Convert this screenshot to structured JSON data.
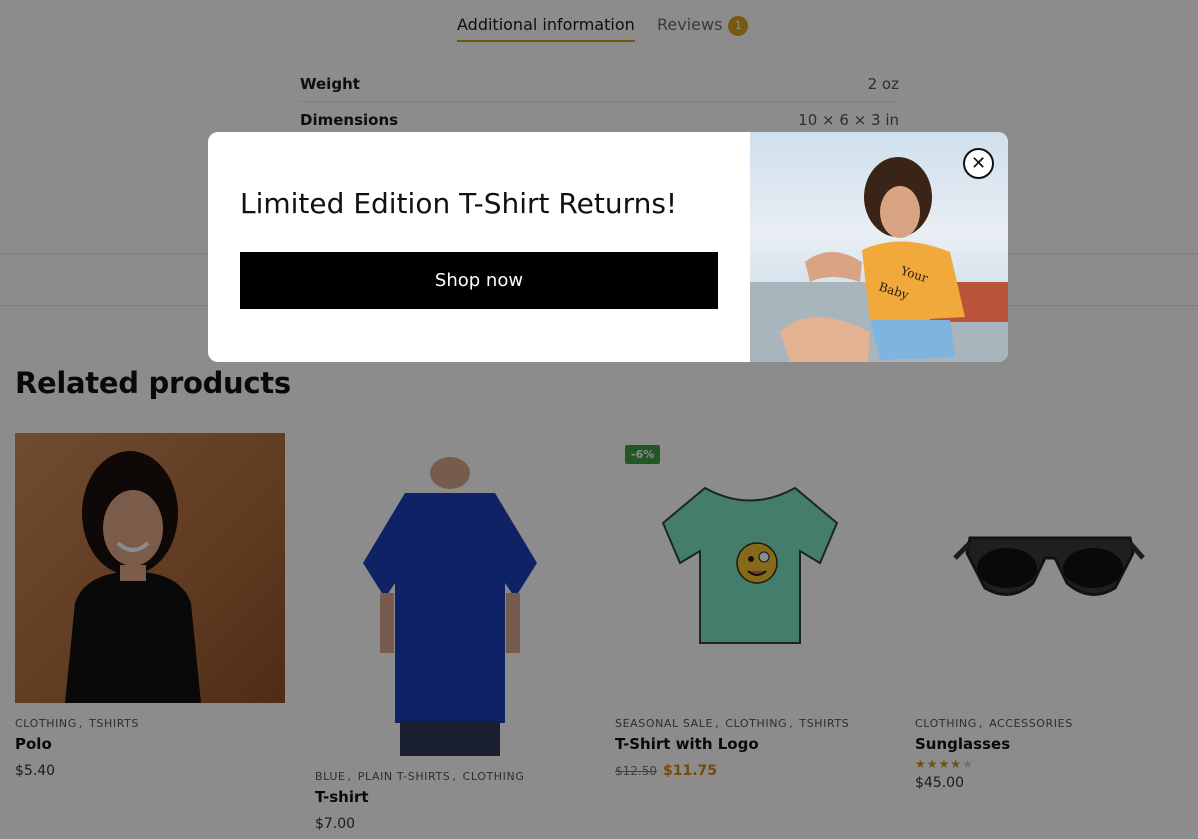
{
  "tabs": {
    "additional_info": "Additional information",
    "reviews": "Reviews",
    "reviews_count": "1"
  },
  "info_table": [
    {
      "label": "Weight",
      "value": "2 oz"
    },
    {
      "label": "Dimensions",
      "value": "10 × 6 × 3 in"
    }
  ],
  "related": {
    "title": "Related products",
    "products": [
      {
        "categories": [
          "CLOTHING",
          "TSHIRTS"
        ],
        "name": "Polo",
        "price": "$5.40"
      },
      {
        "categories": [
          "BLUE",
          "PLAIN T-SHIRTS",
          "CLOTHING"
        ],
        "name": "T-shirt",
        "price": "$7.00"
      },
      {
        "categories": [
          "SEASONAL SALE",
          "CLOTHING",
          "TSHIRTS"
        ],
        "name": "T-Shirt with Logo",
        "old_price": "$12.50",
        "price": "$11.75",
        "badge": "-6%"
      },
      {
        "categories": [
          "CLOTHING",
          "ACCESSORIES"
        ],
        "name": "Sunglasses",
        "price": "$45.00",
        "rating": 4
      }
    ]
  },
  "modal": {
    "title": "Limited Edition T-Shirt Returns!",
    "button": "Shop now",
    "close_icon": "close-icon"
  },
  "colors": {
    "accent": "#d99a1a",
    "sale_badge": "#3fa04a",
    "button_bg": "#000000"
  }
}
